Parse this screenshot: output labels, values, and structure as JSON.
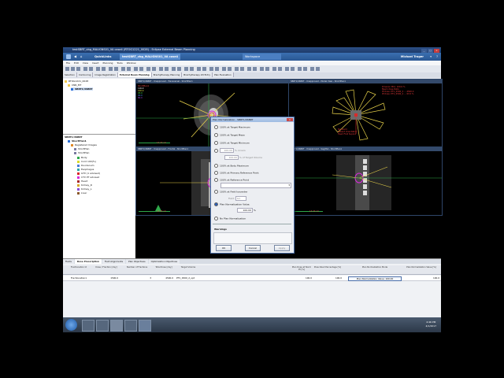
{
  "window": {
    "title": "testSBRT_vbg_MALIGNS01_VA case4 (RTOG1221_0028) - Eclipse External Beam Planning",
    "ribbon": {
      "quicklinks": "QuickLinks",
      "patient_tab": "testSBRT_vbg_MALIGNS01_VA case4 (RTOG1221_0028)",
      "workspace": "Workspace",
      "user": "Michael Trager"
    },
    "menu": [
      "File",
      "Edit",
      "View",
      "Insert",
      "Planning",
      "Tools",
      "Window"
    ],
    "workspace_tabs": [
      {
        "label": "Selection",
        "active": false
      },
      {
        "label": "Contouring",
        "active": false
      },
      {
        "label": "Image Registration",
        "active": false
      },
      {
        "label": "External Beam Planning",
        "active": true
      },
      {
        "label": "Brachytherapy Planning",
        "active": false
      },
      {
        "label": "Brachytherapy 2D Entry",
        "active": false
      },
      {
        "label": "Plan Evaluation",
        "active": false
      }
    ]
  },
  "tree": {
    "top": [
      {
        "label": "RTOG1221_0028",
        "color": "#f2c94c"
      },
      {
        "label": "CNR_MT",
        "color": "#f2c94c"
      },
      {
        "label": "SBRT1/4SBRT",
        "color": "#2a6fd8"
      }
    ],
    "struct_header": "SBRT1/4SBRT",
    "struct_sub": "ShortPlan1",
    "groups": [
      {
        "label": "Registered Images",
        "color": "#e08a2a"
      },
      {
        "label": "ShortPlan",
        "color": "#7a7aa0"
      },
      {
        "label": "ShortPlan",
        "color": "#7a7aa0"
      }
    ],
    "structures": [
      {
        "label": "Body",
        "color": "#2fa84a"
      },
      {
        "label": "Cord 100(%)",
        "color": "#d8d82a"
      },
      {
        "label": "Duodenum",
        "color": "#4a7ad8"
      },
      {
        "label": "Esophagus",
        "color": "#2aa8a8"
      },
      {
        "label": "GTV (1 advised)",
        "color": "#d82a2a"
      },
      {
        "label": "CTV PT advised",
        "color": "#d82ad8"
      },
      {
        "label": "Heart",
        "color": "#a82a2a"
      },
      {
        "label": "Kidney_R",
        "color": "#d8a82a"
      },
      {
        "label": "Kidney_L",
        "color": "#8a4ad8"
      },
      {
        "label": "Liver",
        "color": "#8a5a2a"
      }
    ]
  },
  "viewports": [
    {
      "title": "SBRT1/4SBRT - Unapproved - Transversal - ShortPlan1"
    },
    {
      "title": "SBRT1/4SBRT - Unapproved - Model View - ShortPlan1"
    },
    {
      "title": "SBRT1/4SBRT - Unapproved - Frontal - ShortPlan1"
    },
    {
      "title": "SBRT1/4SBRT - Unapproved - Sagittal - ShortPlan1"
    }
  ],
  "overlays": {
    "tl_info": [
      "ShortPlan1",
      "116.0",
      "100.0",
      "95.0",
      "90.0",
      "80.0"
    ],
    "tl_scale": "13.33 cm",
    "tr_info": [
      "Dmax(in MU): 100.0 %",
      "Beam dose Ratio",
      "IE Dose: PTV_4500_2 ... 4500.0",
      "IE Dose: PTV_4500_2 ... 93.5 %"
    ],
    "tr_label": [
      "Slandard",
      "Patient Orientation",
      "Head First Supine"
    ],
    "bl_scale": "13.33 cm",
    "br_scale": "13.33 cm"
  },
  "bottom": {
    "tabs": [
      {
        "label": "Fields",
        "active": false
      },
      {
        "label": "Dose Prescription",
        "active": true
      },
      {
        "label": "Field Alignments",
        "active": false
      },
      {
        "label": "Plan Objectives",
        "active": false
      },
      {
        "label": "Optimization Objectives",
        "active": false
      }
    ],
    "columns": [
      "Fractionation Id",
      "Dose / Fraction [cGy]",
      "Number of Fractions",
      "Total Dose [cGy]",
      "Target Volume",
      "Plan Dose at Norm Pt [%]",
      "Prescribed Percentage [%]",
      "Plan Normalization Mode",
      "Plan Normalization Value [%]"
    ],
    "row": [
      "Fractionation1",
      "1500.0",
      "3",
      "4500.0",
      "PTV_4500_2_opt",
      "100.0",
      "100.0",
      "Plan Normalization Value: 100.00",
      "100.0"
    ]
  },
  "status": {
    "left": "Ready",
    "items": [
      "User: mt48",
      "Group: Eclipse E",
      "Site: Main",
      "LP 348M",
      "LP 348M (S.P.)"
    ]
  },
  "taskbar": {
    "time": "4:46 PM",
    "date": "4/1/2017"
  },
  "dialog": {
    "title": "Plan Normalization - SBRT1/4SBRT",
    "options": [
      {
        "label": "100% at Target Maximum",
        "selected": false,
        "enabled": true
      },
      {
        "label": "100% at Target Mean",
        "selected": false,
        "enabled": true
      },
      {
        "label": "100% at Target Minimum",
        "selected": false,
        "enabled": true
      },
      {
        "label": "% covers",
        "selected": false,
        "enabled": false
      },
      {
        "label": "% of Target Volume",
        "selected": false,
        "enabled": false
      },
      {
        "label": "100% at Body Maximum",
        "selected": false,
        "enabled": true
      },
      {
        "label": "100% at Primary Reference Point",
        "selected": false,
        "enabled": true
      },
      {
        "label": "100% at Reference Point",
        "selected": false,
        "enabled": true
      },
      {
        "label": "100% at Field Isocenter",
        "selected": false,
        "enabled": true
      },
      {
        "label": "Plan Normalization Value:",
        "selected": true,
        "enabled": true
      },
      {
        "label": "No Plan Normalization",
        "selected": false,
        "enabled": true
      }
    ],
    "covers_value": "100.00",
    "volume_value": "100.00",
    "field_label": "Field:",
    "field_value": "G1",
    "norm_value": "100.00",
    "norm_unit": "%",
    "warnings": "Warnings",
    "ok": "OK",
    "cancel": "Cancel",
    "apply": "Apply"
  }
}
